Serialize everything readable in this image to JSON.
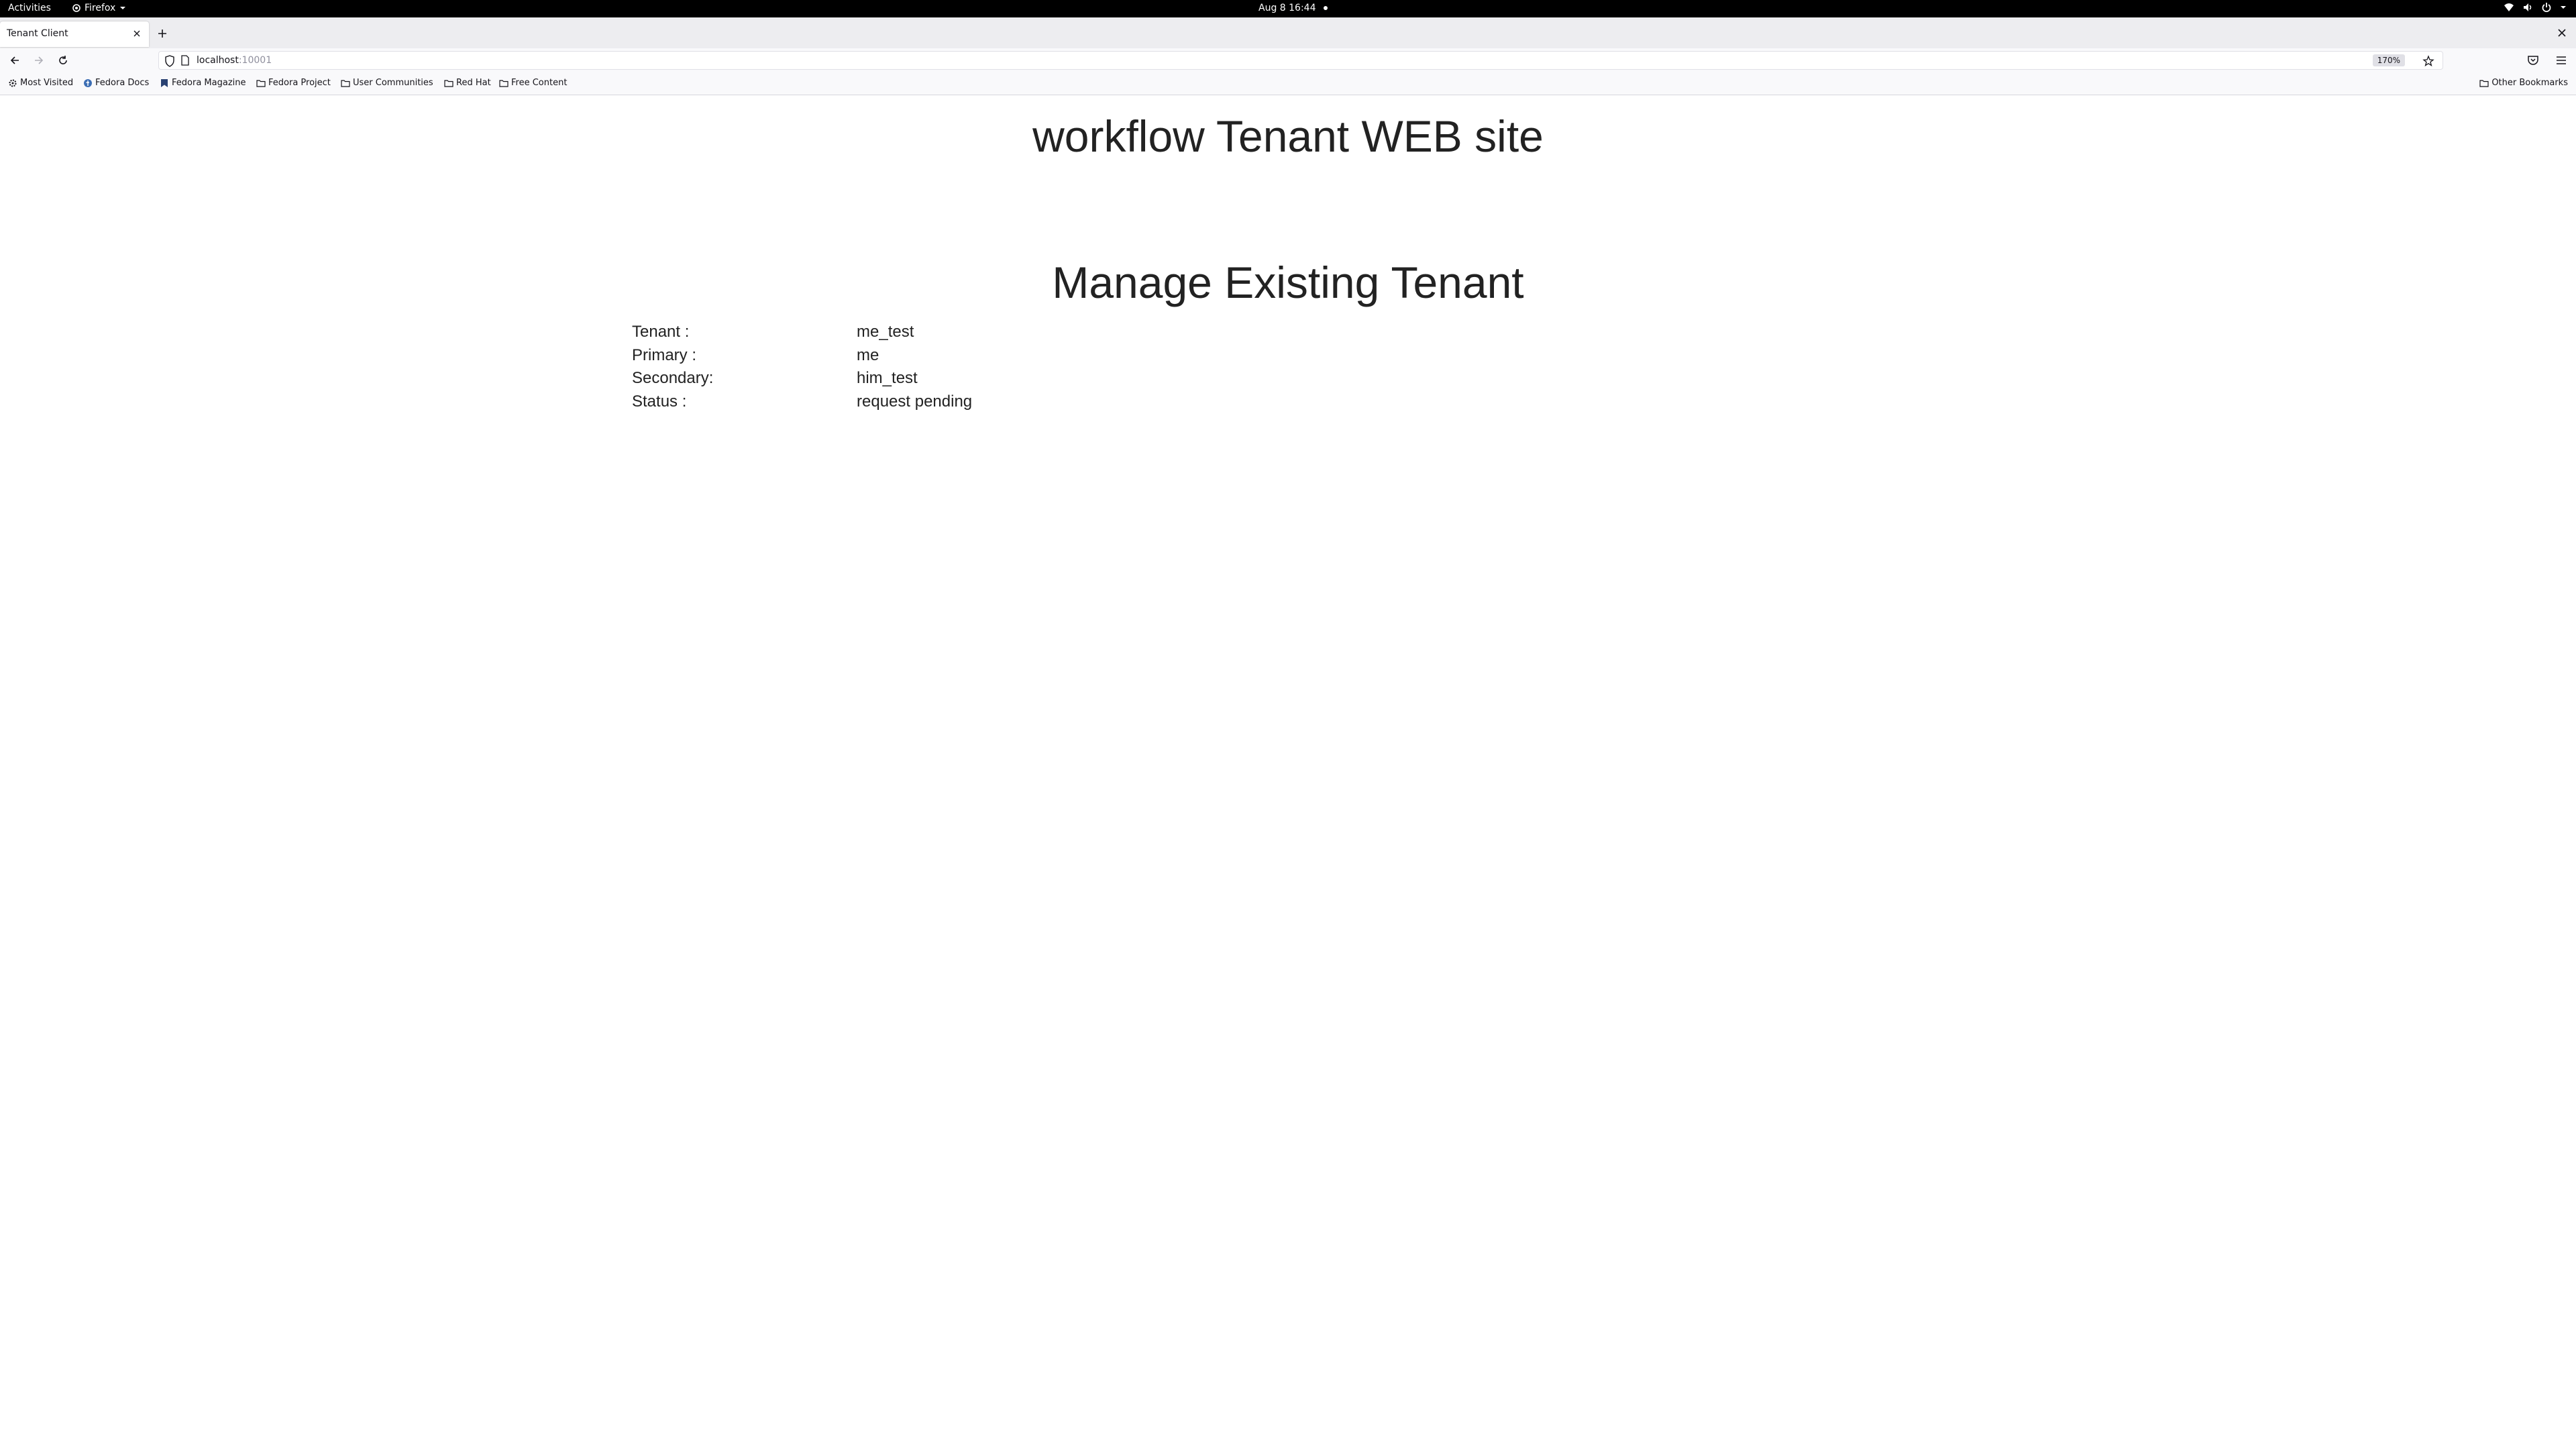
{
  "system_bar": {
    "activities": "Activities",
    "app_name": "Firefox",
    "clock": "Aug 8  16:44"
  },
  "browser": {
    "tab_title": "Tenant Client",
    "url_host": "localhost",
    "url_port": ":10001",
    "zoom": "170%",
    "bookmarks": [
      {
        "label": "Most Visited",
        "icon": "gear-icon"
      },
      {
        "label": "Fedora Docs",
        "icon": "fedora-icon"
      },
      {
        "label": "Fedora Magazine",
        "icon": "magazine-icon"
      },
      {
        "label": "Fedora Project",
        "icon": "folder-icon"
      },
      {
        "label": "User Communities",
        "icon": "folder-icon"
      },
      {
        "label": "Red Hat",
        "icon": "folder-icon"
      },
      {
        "label": "Free Content",
        "icon": "folder-icon"
      }
    ],
    "other_bookmarks": "Other Bookmarks"
  },
  "page": {
    "site_title": "workflow Tenant WEB site",
    "section_title": "Manage Existing Tenant",
    "fields": [
      {
        "label": "Tenant :",
        "value": "me_test"
      },
      {
        "label": "Primary :",
        "value": "me"
      },
      {
        "label": "Secondary:",
        "value": "him_test"
      },
      {
        "label": "Status :",
        "value": "request pending"
      }
    ]
  }
}
